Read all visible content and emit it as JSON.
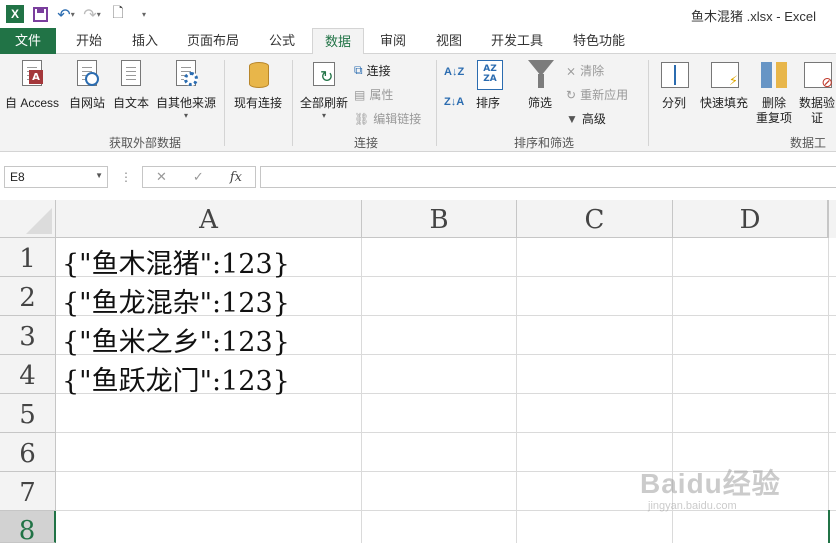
{
  "window": {
    "title": "鱼木混猪 .xlsx - Excel"
  },
  "tabs": [
    {
      "id": "file",
      "label": "文件"
    },
    {
      "id": "home",
      "label": "开始"
    },
    {
      "id": "insert",
      "label": "插入"
    },
    {
      "id": "layout",
      "label": "页面布局"
    },
    {
      "id": "formulas",
      "label": "公式"
    },
    {
      "id": "data",
      "label": "数据",
      "active": true
    },
    {
      "id": "review",
      "label": "审阅"
    },
    {
      "id": "view",
      "label": "视图"
    },
    {
      "id": "dev",
      "label": "开发工具"
    },
    {
      "id": "special",
      "label": "特色功能"
    }
  ],
  "ribbon": {
    "get_external": {
      "group_label": "获取外部数据",
      "from_access": "自 Access",
      "from_web": "自网站",
      "from_text": "自文本",
      "from_other": "自其他来源",
      "existing": "现有连接"
    },
    "connections": {
      "group_label": "连接",
      "refresh_all": "全部刷新",
      "connections": "连接",
      "properties": "属性",
      "edit_links": "编辑链接"
    },
    "sort_filter": {
      "group_label": "排序和筛选",
      "sort": "排序",
      "filter": "筛选",
      "clear": "清除",
      "reapply": "重新应用",
      "advanced": "高级"
    },
    "data_tools": {
      "group_label": "数据工",
      "split": "分列",
      "flash_fill": "快速填充",
      "remove_dup_1": "删除",
      "remove_dup_2": "重复项",
      "validation_1": "数据验",
      "validation_2": "证"
    }
  },
  "formula_bar": {
    "name_box": "E8",
    "cancel_glyph": "✕",
    "enter_glyph": "✓",
    "fx_label": "fx",
    "value": ""
  },
  "sheet": {
    "columns": [
      "A",
      "B",
      "C",
      "D"
    ],
    "rows": [
      "1",
      "2",
      "3",
      "4",
      "5",
      "6",
      "7",
      "8"
    ],
    "cells": [
      {
        "ref": "A1",
        "value": "{\"鱼木混猪\":123}"
      },
      {
        "ref": "A2",
        "value": "{\"鱼龙混杂\":123}"
      },
      {
        "ref": "A3",
        "value": "{\"鱼米之乡\":123}"
      },
      {
        "ref": "A4",
        "value": "{\"鱼跃龙门\":123}"
      }
    ],
    "selected_row": "8"
  },
  "watermark": {
    "main": "Baidu经验",
    "sub": "jingyan.baidu.com"
  },
  "colors": {
    "accent": "#217346",
    "ribbon_bg": "#f3f3f3",
    "grid_line": "#dadada"
  }
}
